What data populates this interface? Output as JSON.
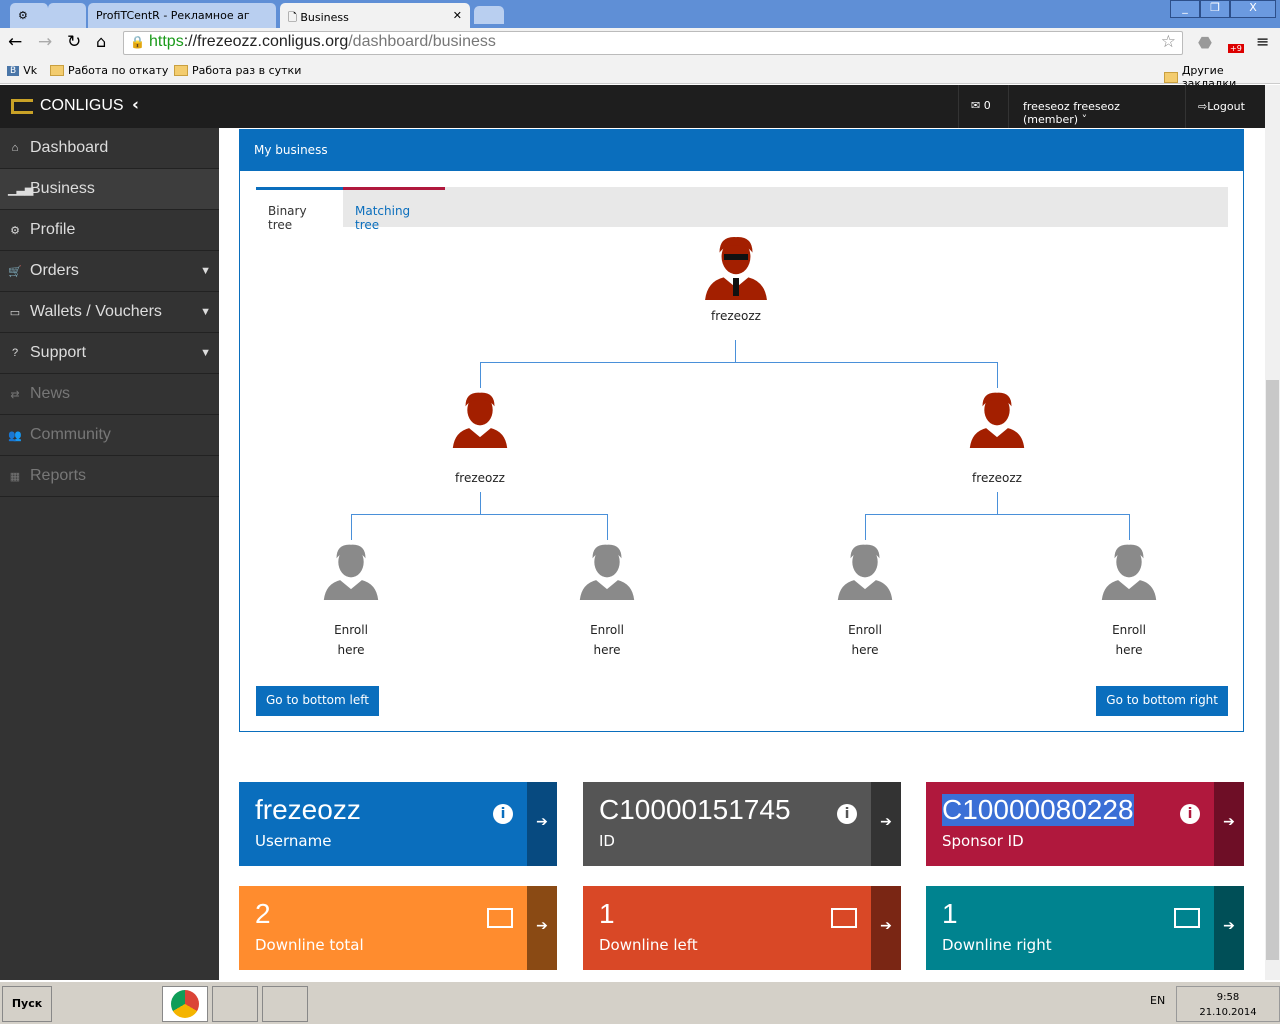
{
  "browser": {
    "tabs": [
      {
        "label": ""
      },
      {
        "label": ""
      },
      {
        "label": "ProfiTCentR - Рекламное аг"
      },
      {
        "label": "Business"
      }
    ],
    "url_scheme": "https",
    "url_host": "://frezeozz.conligus.org",
    "url_path": "/dashboard/business",
    "bookmarks": [
      "Vk",
      "Работа по откату",
      "Работа раз в сутки"
    ],
    "other_bookmarks": "Другие закладки",
    "extension_badge": "+9"
  },
  "app": {
    "logo": "CONLIGUS",
    "messages_count": "0",
    "user": "freeseoz freeseoz (member)",
    "logout": "Logout"
  },
  "sidebar": {
    "items": [
      {
        "label": "Dashboard",
        "icon": "home-icon"
      },
      {
        "label": "Business",
        "icon": "bar-chart-icon"
      },
      {
        "label": "Profile",
        "icon": "gear-icon"
      },
      {
        "label": "Orders",
        "icon": "cart-icon"
      },
      {
        "label": "Wallets / Vouchers",
        "icon": "money-icon"
      },
      {
        "label": "Support",
        "icon": "help-icon"
      },
      {
        "label": "News",
        "icon": "exchange-icon"
      },
      {
        "label": "Community",
        "icon": "users-icon"
      },
      {
        "label": "Reports",
        "icon": "calendar-icon"
      }
    ]
  },
  "panel": {
    "title": "My business",
    "tabs": [
      "Binary tree",
      "Matching tree"
    ],
    "tree": {
      "root": "frezeozz",
      "left": "frezeozz",
      "right": "frezeozz",
      "enroll_line1": "Enroll",
      "enroll_line2": "here"
    },
    "btn_left": "Go to bottom left",
    "btn_right": "Go to bottom right"
  },
  "stats": [
    {
      "value": "frezeozz",
      "label": "Username",
      "color": "#0a6ebd",
      "side": "#074a80"
    },
    {
      "value": "C10000151745",
      "label": "ID",
      "color": "#555555",
      "side": "#333333"
    },
    {
      "value": "C10000080228",
      "label": "Sponsor ID",
      "color": "#b0183d",
      "side": "#6e0e26"
    },
    {
      "value": "2",
      "label": "Downline total",
      "color": "#ff8c2e",
      "side": "#8a4a14"
    },
    {
      "value": "1",
      "label": "Downline left",
      "color": "#d94826",
      "side": "#7a2614"
    },
    {
      "value": "1",
      "label": "Downline right",
      "color": "#00838f",
      "side": "#004f57"
    }
  ],
  "taskbar": {
    "start": "Пуск",
    "lang": "EN",
    "time": "9:58",
    "date": "21.10.2014"
  }
}
